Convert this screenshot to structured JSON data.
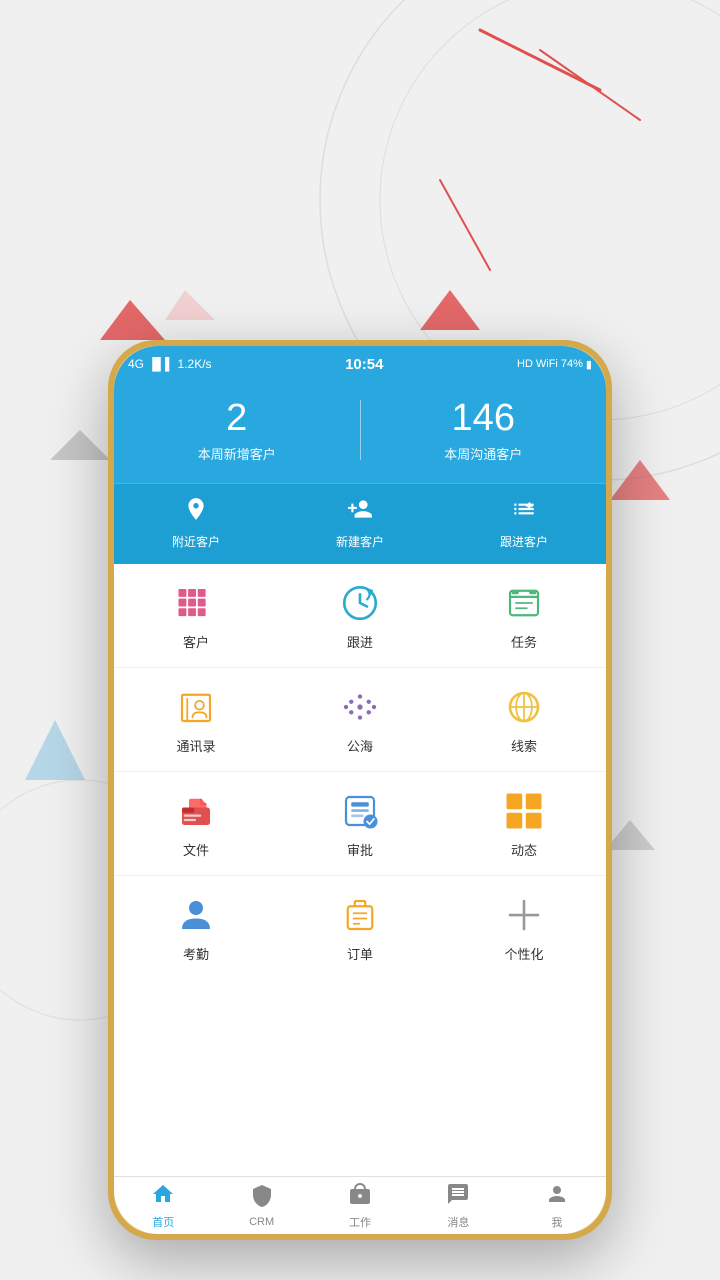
{
  "background": {
    "color": "#eeeeee"
  },
  "statusBar": {
    "carrier": "4G",
    "signal": "|||",
    "speed": "1.2K/s",
    "time": "10:54",
    "battery": "74%",
    "icons": "HD"
  },
  "header": {
    "stat1_number": "2",
    "stat1_label": "本周新增客户",
    "stat2_number": "146",
    "stat2_label": "本周沟通客户"
  },
  "quickActions": [
    {
      "id": "nearby",
      "label": "附近客户"
    },
    {
      "id": "new-customer",
      "label": "新建客户"
    },
    {
      "id": "follow-up",
      "label": "跟进客户"
    }
  ],
  "gridRows": [
    [
      {
        "id": "customer",
        "label": "客户",
        "color": "#e05a8a"
      },
      {
        "id": "follow",
        "label": "跟进",
        "color": "#2aabcc"
      },
      {
        "id": "task",
        "label": "任务",
        "color": "#4db87a"
      }
    ],
    [
      {
        "id": "contacts",
        "label": "通讯录",
        "color": "#f5a623"
      },
      {
        "id": "public-sea",
        "label": "公海",
        "color": "#8a6db0"
      },
      {
        "id": "clue",
        "label": "线索",
        "color": "#f0c040"
      }
    ],
    [
      {
        "id": "file",
        "label": "文件",
        "color": "#e05050"
      },
      {
        "id": "approve",
        "label": "审批",
        "color": "#4a90d9"
      },
      {
        "id": "dynamic",
        "label": "动态",
        "color": "#f5a623"
      }
    ],
    [
      {
        "id": "attendance",
        "label": "考勤",
        "color": "#4a90d9"
      },
      {
        "id": "order",
        "label": "订单",
        "color": "#f5a623"
      },
      {
        "id": "personalize",
        "label": "个性化",
        "color": "#888888"
      }
    ]
  ],
  "bottomNav": [
    {
      "id": "home",
      "label": "首页",
      "active": true
    },
    {
      "id": "crm",
      "label": "CRM",
      "active": false
    },
    {
      "id": "work",
      "label": "工作",
      "active": false
    },
    {
      "id": "message",
      "label": "消息",
      "active": false
    },
    {
      "id": "me",
      "label": "我",
      "active": false
    }
  ]
}
